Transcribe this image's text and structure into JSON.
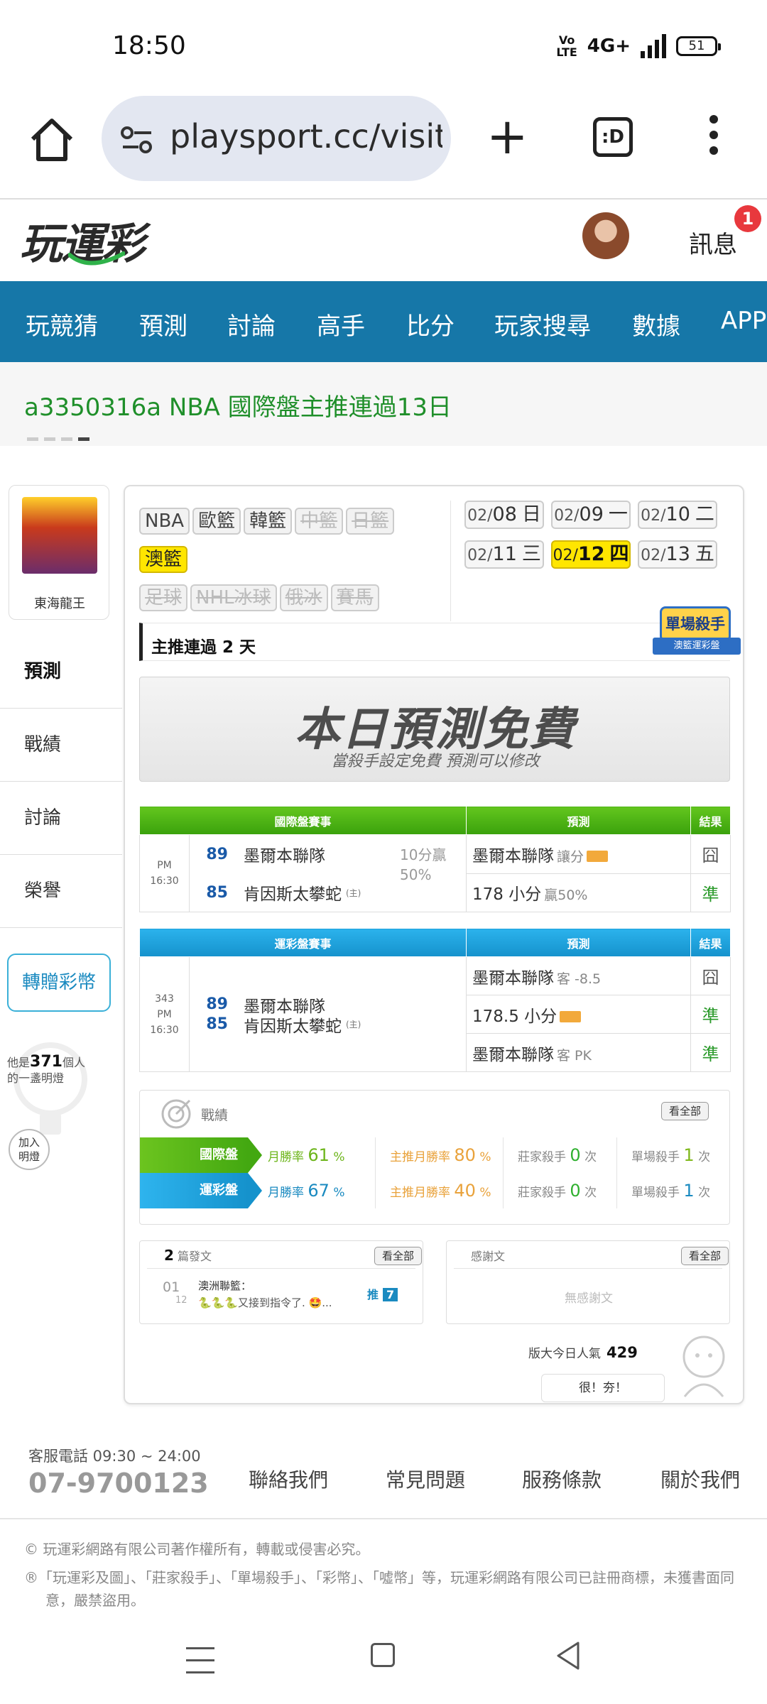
{
  "status": {
    "time": "18:50",
    "volte": "Vo\nLTE",
    "network": "4G+",
    "battery": "51"
  },
  "browser": {
    "url": "playsport.cc/visit",
    "tabs_label": ":D"
  },
  "header": {
    "logo": "玩運彩",
    "messages": "訊息",
    "message_count": "1"
  },
  "nav": {
    "items": [
      "玩競猜",
      "預測",
      "討論",
      "高手",
      "比分",
      "玩家搜尋",
      "數據",
      "APP"
    ]
  },
  "marquee": {
    "text": "a3350316a NBA 國際盤主推連過13日"
  },
  "profile": {
    "name": "東海龍王"
  },
  "side_menu": [
    "預測",
    "戰績",
    "討論",
    "榮譽"
  ],
  "gift_button": "轉贈彩幣",
  "light": {
    "prefix": "他是",
    "count": "371",
    "suffix": "個人",
    "line2": "的一盞明燈",
    "join": "加入明燈"
  },
  "sports": {
    "row1": [
      {
        "label": "NBA",
        "state": "on"
      },
      {
        "label": "歐籃",
        "state": "on"
      },
      {
        "label": "韓籃",
        "state": "on"
      },
      {
        "label": "中籃",
        "state": "off"
      },
      {
        "label": "日籃",
        "state": "off"
      }
    ],
    "row2": [
      {
        "label": "澳籃",
        "state": "sel"
      }
    ],
    "row3": [
      {
        "label": "足球",
        "state": "off"
      },
      {
        "label": "NHL冰球",
        "state": "off"
      },
      {
        "label": "俄冰",
        "state": "off"
      },
      {
        "label": "賽馬",
        "state": "off"
      }
    ]
  },
  "dates": [
    {
      "md": "02/",
      "d": "08",
      "w": "日",
      "sel": false
    },
    {
      "md": "02/",
      "d": "09",
      "w": "一",
      "sel": false
    },
    {
      "md": "02/",
      "d": "10",
      "w": "二",
      "sel": false
    },
    {
      "md": "02/",
      "d": "11",
      "w": "三",
      "sel": false
    },
    {
      "md": "02/",
      "d": "12",
      "w": "四",
      "sel": true
    },
    {
      "md": "02/",
      "d": "13",
      "w": "五",
      "sel": false
    }
  ],
  "streak": {
    "text": "主推連過 2 天",
    "badge_top": "單場殺手",
    "badge_bottom": "澳籃運彩盤"
  },
  "free_banner": {
    "title": "本日預測免費",
    "subtitle": "當殺手設定免費 預測可以修改"
  },
  "intl_table": {
    "head": [
      "國際盤賽事",
      "預測",
      "結果"
    ],
    "time": "PM 16:30",
    "teams": [
      {
        "score": "89",
        "name": "墨爾本聯隊",
        "home": false
      },
      {
        "score": "85",
        "name": "肯因斯太攀蛇",
        "home": true
      }
    ],
    "home_tag": "(主)",
    "line": "10分贏",
    "line_pct": "50%",
    "picks": [
      {
        "main": "墨爾本聯隊",
        "note": "讓分",
        "mini": true,
        "result": "囧",
        "ok": false
      },
      {
        "main": "178 小分",
        "note": "贏50%",
        "mini": false,
        "result": "準",
        "ok": true
      }
    ]
  },
  "sport_table": {
    "head": [
      "運彩盤賽事",
      "預測",
      "結果"
    ],
    "game_no": "343",
    "time": "PM 16:30",
    "teams": [
      {
        "score": "89",
        "name": "墨爾本聯隊",
        "home": false
      },
      {
        "score": "85",
        "name": "肯因斯太攀蛇",
        "home": true
      }
    ],
    "home_tag": "(主)",
    "picks": [
      {
        "main": "墨爾本聯隊",
        "note": "客 -8.5",
        "mini": false,
        "result": "囧",
        "ok": false
      },
      {
        "main": "178.5 小分",
        "note": "",
        "mini": true,
        "result": "準",
        "ok": true
      },
      {
        "main": "墨爾本聯隊",
        "note": "客 PK",
        "mini": false,
        "result": "準",
        "ok": true
      }
    ]
  },
  "record": {
    "title": "戰績",
    "see_all": "看全部",
    "rows": [
      {
        "tag": "國際盤",
        "color": "green",
        "month_label": "月勝率",
        "month": "61",
        "main_label": "主推月勝率",
        "main": "80",
        "banker_label": "莊家殺手",
        "banker": "0",
        "single_label": "單場殺手",
        "single": "1",
        "unit_pct": "%",
        "unit_times": "次"
      },
      {
        "tag": "運彩盤",
        "color": "blue",
        "month_label": "月勝率",
        "month": "67",
        "main_label": "主推月勝率",
        "main": "40",
        "banker_label": "莊家殺手",
        "banker": "0",
        "single_label": "單場殺手",
        "single": "1",
        "unit_pct": "%",
        "unit_times": "次"
      }
    ]
  },
  "posts": {
    "count": "2",
    "label": "篇發文",
    "see_all": "看全部",
    "num": "01",
    "total": "12",
    "title": "澳洲聯籃：",
    "preview": "🐍🐍🐍又接到指令了. 🤩...",
    "push_label": "推",
    "push_count": "7"
  },
  "thanks": {
    "label": "感謝文",
    "see_all": "看全部",
    "empty": "無感謝文"
  },
  "popularity": {
    "label": "版大今日人氣",
    "value": "429",
    "cool": "很！夯！"
  },
  "footer": {
    "cs_label": "客服電話 09:30 ~ 24:00",
    "cs_phone": "07-9700123",
    "links": [
      "聯絡我們",
      "常見問題",
      "服務條款",
      "關於我們"
    ],
    "copyright1": "© 玩運彩網路有限公司著作權所有，轉載或侵害必究。",
    "copyright2": "®「玩運彩及圖」、「莊家殺手」、「單場殺手」、「彩幣」、「噓幣」等，玩運彩網路有限公司已註冊商標，未獲書面同意，嚴禁盜用。"
  },
  "colors": {
    "nav_bg": "#1677a8",
    "intl_green": "#43a811",
    "sport_blue": "#1592cc",
    "marquee_green": "#1f8f2a",
    "badge_red": "#e8383d",
    "selected_yellow": "#ffe600"
  }
}
